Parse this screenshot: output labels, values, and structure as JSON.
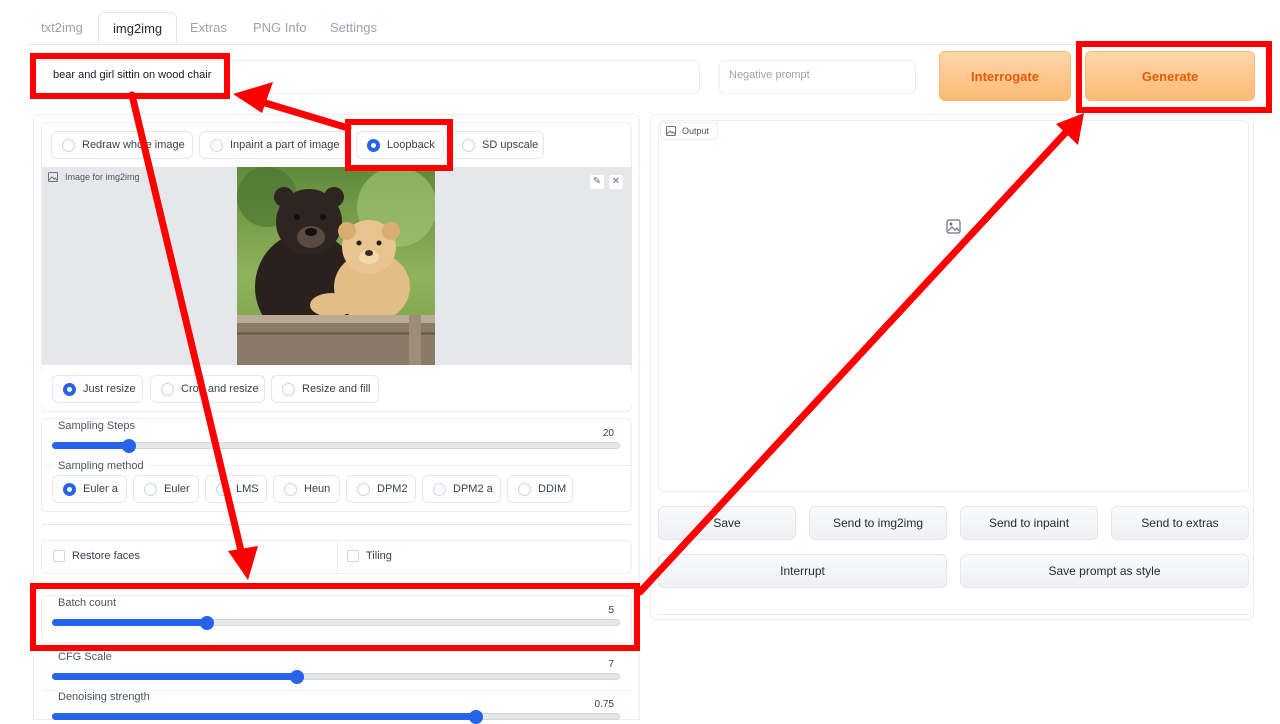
{
  "tabs": [
    {
      "label": "txt2img"
    },
    {
      "label": "img2img"
    },
    {
      "label": "Extras"
    },
    {
      "label": "PNG Info"
    },
    {
      "label": "Settings"
    }
  ],
  "prompt": {
    "value": "bear and girl sittin on wood chair"
  },
  "negative_prompt": {
    "placeholder": "Negative prompt"
  },
  "buttons": {
    "interrogate": "Interrogate",
    "generate": "Generate"
  },
  "mode_radios": [
    {
      "label": "Redraw whole image",
      "checked": false
    },
    {
      "label": "Inpaint a part of image",
      "checked": false
    },
    {
      "label": "Loopback",
      "checked": true
    },
    {
      "label": "SD upscale",
      "checked": false
    }
  ],
  "image_panel": {
    "label": "Image for img2img"
  },
  "resize_radios": [
    {
      "label": "Just resize",
      "checked": true
    },
    {
      "label": "Crop and resize",
      "checked": false
    },
    {
      "label": "Resize and fill",
      "checked": false
    }
  ],
  "sampling_steps": {
    "label": "Sampling Steps",
    "value": "20"
  },
  "sampling_method": {
    "label": "Sampling method",
    "options": [
      {
        "label": "Euler a",
        "checked": true
      },
      {
        "label": "Euler",
        "checked": false
      },
      {
        "label": "LMS",
        "checked": false
      },
      {
        "label": "Heun",
        "checked": false
      },
      {
        "label": "DPM2",
        "checked": false
      },
      {
        "label": "DPM2 a",
        "checked": false
      },
      {
        "label": "DDIM",
        "checked": false
      }
    ]
  },
  "checks": {
    "restore_faces": "Restore faces",
    "tiling": "Tiling"
  },
  "batch_count": {
    "label": "Batch count",
    "value": "5"
  },
  "cfg_scale": {
    "label": "CFG Scale",
    "value": "7"
  },
  "denoising": {
    "label": "Denoising strength",
    "value": "0.75"
  },
  "output": {
    "label": "Output"
  },
  "output_buttons": {
    "save": "Save",
    "send_img2img": "Send to img2img",
    "send_inpaint": "Send to inpaint",
    "send_extras": "Send to extras",
    "interrupt": "Interrupt",
    "save_style": "Save prompt as style"
  },
  "colors": {
    "accent": "#2563eb",
    "annotation": "#ff0000",
    "generate": "#ea580c"
  }
}
